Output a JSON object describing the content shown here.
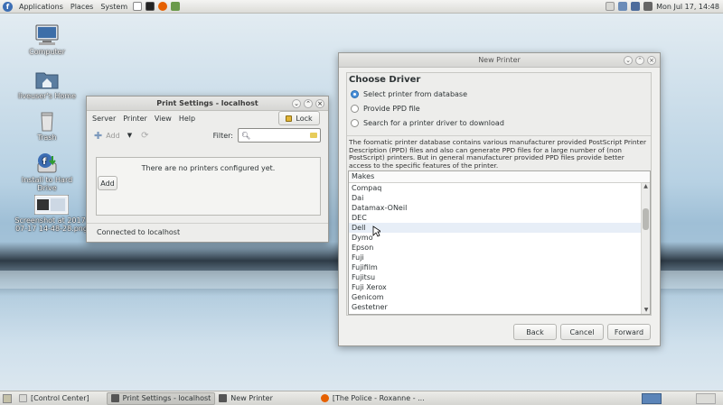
{
  "top_panel": {
    "menus": [
      "Applications",
      "Places",
      "System"
    ],
    "clock": "Mon Jul 17, 14:48"
  },
  "desktop": {
    "icons": [
      {
        "label": "Computer"
      },
      {
        "label": "liveuser's Home"
      },
      {
        "label": "Trash"
      },
      {
        "label": "Install to Hard Drive"
      },
      {
        "label": "Screenshot at 2017-07-17 14-48-28.png"
      }
    ]
  },
  "print_settings": {
    "title": "Print Settings - localhost",
    "menus": [
      "Server",
      "Printer",
      "View",
      "Help"
    ],
    "lock_label": "Lock",
    "add_label": "Add",
    "filter_label": "Filter:",
    "filter_value": "",
    "empty_message": "There are no printers configured yet.",
    "add_button": "Add",
    "status": "Connected to localhost"
  },
  "new_printer": {
    "title": "New Printer",
    "heading": "Choose Driver",
    "options": [
      {
        "label": "Select printer from database",
        "selected": true
      },
      {
        "label": "Provide PPD file",
        "selected": false
      },
      {
        "label": "Search for a printer driver to download",
        "selected": false
      }
    ],
    "description": "The foomatic printer database contains various manufacturer provided PostScript Printer Description (PPD) files and also can generate PPD files for a large number of (non PostScript) printers. But in general manufacturer provided PPD files provide better access to the specific features of the printer.",
    "makes_header": "Makes",
    "makes": [
      "Compaq",
      "Dai",
      "Datamax-ONeil",
      "DEC",
      "Dell",
      "Dymo",
      "Epson",
      "Fuji",
      "Fujifilm",
      "Fujitsu",
      "Fuji Xerox",
      "Genicom",
      "Gestetner"
    ],
    "highlighted_make": "Dell",
    "back_label": "Back",
    "cancel_label": "Cancel",
    "forward_label": "Forward"
  },
  "taskbar": {
    "tasks": [
      {
        "label": "[Control Center]"
      },
      {
        "label": "Print Settings - localhost"
      },
      {
        "label": "New Printer"
      },
      {
        "label": "[The Police - Roxanne - ..."
      }
    ]
  },
  "colors": {
    "selection": "#4a90d9",
    "hover_row": "#e7eef7"
  }
}
